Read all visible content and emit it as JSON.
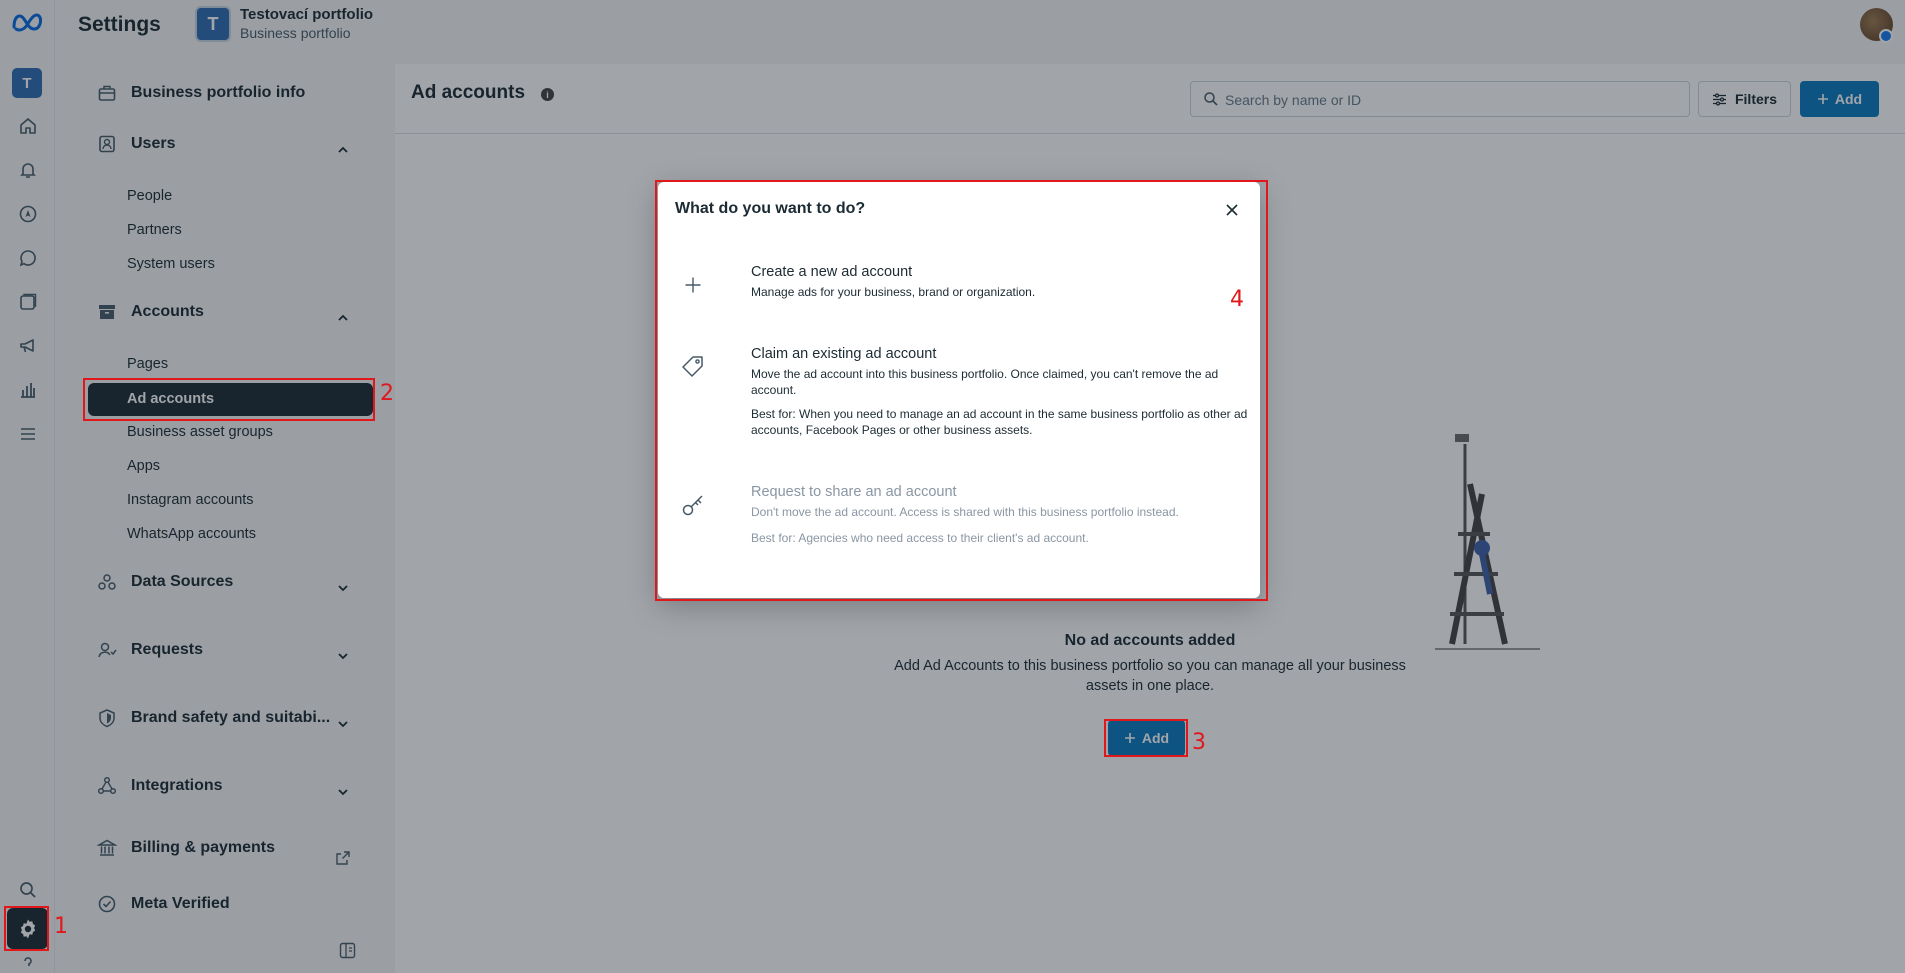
{
  "topbar": {
    "title": "Settings",
    "portfolio_initial": "T",
    "portfolio_name": "Testovací portfolio",
    "portfolio_type": "Business portfolio"
  },
  "rail": {
    "workspace_initial": "T",
    "icons": [
      "meta-logo-icon",
      "home-icon",
      "bell-icon",
      "compass-icon",
      "chat-icon",
      "pages-icon",
      "megaphone-icon",
      "chart-icon",
      "menu-icon",
      "search-icon",
      "gear-icon",
      "help-icon"
    ]
  },
  "sidebar": {
    "business_info": "Business portfolio info",
    "users": {
      "label": "Users",
      "items": [
        "People",
        "Partners",
        "System users"
      ]
    },
    "accounts": {
      "label": "Accounts",
      "items": [
        "Pages",
        "Ad accounts",
        "Business asset groups",
        "Apps",
        "Instagram accounts",
        "WhatsApp accounts"
      ],
      "active": "Ad accounts"
    },
    "data_sources": "Data Sources",
    "requests": "Requests",
    "brand_safety": "Brand safety and suitabi...",
    "integrations": "Integrations",
    "billing": "Billing & payments",
    "meta_verified": "Meta Verified"
  },
  "main": {
    "title": "Ad accounts",
    "search_placeholder": "Search by name or ID",
    "filters_label": "Filters",
    "add_label": "Add",
    "empty_title": "No ad accounts added",
    "empty_desc": "Add Ad Accounts to this business portfolio so you can manage all your business assets in one place.",
    "empty_add_label": "Add"
  },
  "modal": {
    "title": "What do you want to do?",
    "options": [
      {
        "title": "Create a new ad account",
        "desc": "Manage ads for your business, brand or organization.",
        "icon": "plus-icon"
      },
      {
        "title": "Claim an existing ad account",
        "desc": "Move the ad account into this business portfolio. Once claimed, you can't remove the ad account.",
        "best": "Best for: When you need to manage an ad account in the same business portfolio as other ad accounts, Facebook Pages or other business assets.",
        "icon": "tag-icon"
      },
      {
        "title": "Request to share an ad account",
        "desc": "Don't move the ad account. Access is shared with this business portfolio instead.",
        "best": "Best for: Agencies who need access to their client's ad account.",
        "icon": "key-icon"
      }
    ]
  },
  "annotations": [
    "1",
    "2",
    "3",
    "4"
  ],
  "colors": {
    "primary": "#0a78be",
    "dark": "#1c2b33",
    "annotation": "#e0181b"
  }
}
